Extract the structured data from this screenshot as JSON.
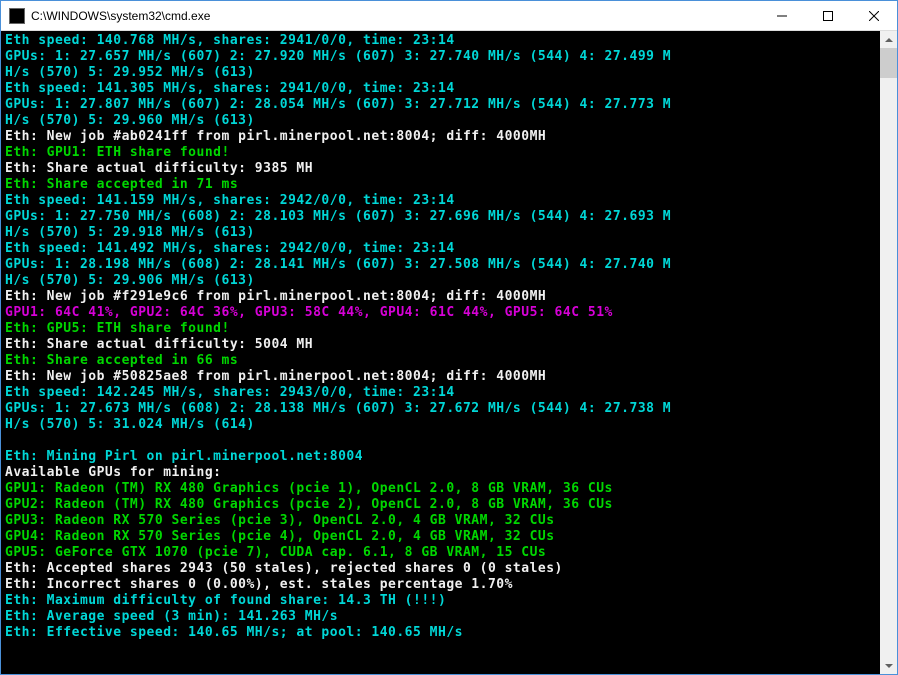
{
  "window": {
    "title": "C:\\WINDOWS\\system32\\cmd.exe"
  },
  "lines": [
    {
      "cls": "cyan",
      "key": "l00",
      "text": "Eth speed: 140.768 MH/s, shares: 2941/0/0, time: 23:14"
    },
    {
      "cls": "cyan",
      "key": "l01",
      "text": "GPUs: 1: 27.657 MH/s (607) 2: 27.920 MH/s (607) 3: 27.740 MH/s (544) 4: 27.499 M"
    },
    {
      "cls": "cyan",
      "key": "l02",
      "text": "H/s (570) 5: 29.952 MH/s (613)"
    },
    {
      "cls": "cyan",
      "key": "l03",
      "text": "Eth speed: 141.305 MH/s, shares: 2941/0/0, time: 23:14"
    },
    {
      "cls": "cyan",
      "key": "l04",
      "text": "GPUs: 1: 27.807 MH/s (607) 2: 28.054 MH/s (607) 3: 27.712 MH/s (544) 4: 27.773 M"
    },
    {
      "cls": "cyan",
      "key": "l05",
      "text": "H/s (570) 5: 29.960 MH/s (613)"
    },
    {
      "cls": "white",
      "key": "l06",
      "text": "Eth: New job #ab0241ff from pirl.minerpool.net:8004; diff: 4000MH"
    },
    {
      "cls": "green",
      "key": "l07",
      "text": "Eth: GPU1: ETH share found!"
    },
    {
      "cls": "white",
      "key": "l08",
      "text": "Eth: Share actual difficulty: 9385 MH"
    },
    {
      "cls": "green",
      "key": "l09",
      "text": "Eth: Share accepted in 71 ms"
    },
    {
      "cls": "cyan",
      "key": "l10",
      "text": "Eth speed: 141.159 MH/s, shares: 2942/0/0, time: 23:14"
    },
    {
      "cls": "cyan",
      "key": "l11",
      "text": "GPUs: 1: 27.750 MH/s (608) 2: 28.103 MH/s (607) 3: 27.696 MH/s (544) 4: 27.693 M"
    },
    {
      "cls": "cyan",
      "key": "l12",
      "text": "H/s (570) 5: 29.918 MH/s (613)"
    },
    {
      "cls": "cyan",
      "key": "l13",
      "text": "Eth speed: 141.492 MH/s, shares: 2942/0/0, time: 23:14"
    },
    {
      "cls": "cyan",
      "key": "l14",
      "text": "GPUs: 1: 28.198 MH/s (608) 2: 28.141 MH/s (607) 3: 27.508 MH/s (544) 4: 27.740 M"
    },
    {
      "cls": "cyan",
      "key": "l15",
      "text": "H/s (570) 5: 29.906 MH/s (613)"
    },
    {
      "cls": "white",
      "key": "l16",
      "text": "Eth: New job #f291e9c6 from pirl.minerpool.net:8004; diff: 4000MH"
    },
    {
      "cls": "magenta",
      "key": "l17",
      "text": "GPU1: 64C 41%, GPU2: 64C 36%, GPU3: 58C 44%, GPU4: 61C 44%, GPU5: 64C 51%"
    },
    {
      "cls": "green",
      "key": "l18",
      "text": "Eth: GPU5: ETH share found!"
    },
    {
      "cls": "white",
      "key": "l19",
      "text": "Eth: Share actual difficulty: 5004 MH"
    },
    {
      "cls": "green",
      "key": "l20",
      "text": "Eth: Share accepted in 66 ms"
    },
    {
      "cls": "white",
      "key": "l21",
      "text": "Eth: New job #50825ae8 from pirl.minerpool.net:8004; diff: 4000MH"
    },
    {
      "cls": "cyan",
      "key": "l22",
      "text": "Eth speed: 142.245 MH/s, shares: 2943/0/0, time: 23:14"
    },
    {
      "cls": "cyan",
      "key": "l23",
      "text": "GPUs: 1: 27.673 MH/s (608) 2: 28.138 MH/s (607) 3: 27.672 MH/s (544) 4: 27.738 M"
    },
    {
      "cls": "cyan",
      "key": "l24",
      "text": "H/s (570) 5: 31.024 MH/s (614)"
    },
    {
      "cls": "",
      "key": "l25",
      "text": " "
    },
    {
      "cls": "cyan",
      "key": "l26",
      "text": "Eth: Mining Pirl on pirl.minerpool.net:8004"
    },
    {
      "cls": "white",
      "key": "l27",
      "text": "Available GPUs for mining:"
    },
    {
      "cls": "green",
      "key": "l28",
      "text": "GPU1: Radeon (TM) RX 480 Graphics (pcie 1), OpenCL 2.0, 8 GB VRAM, 36 CUs"
    },
    {
      "cls": "green",
      "key": "l29",
      "text": "GPU2: Radeon (TM) RX 480 Graphics (pcie 2), OpenCL 2.0, 8 GB VRAM, 36 CUs"
    },
    {
      "cls": "green",
      "key": "l30",
      "text": "GPU3: Radeon RX 570 Series (pcie 3), OpenCL 2.0, 4 GB VRAM, 32 CUs"
    },
    {
      "cls": "green",
      "key": "l31",
      "text": "GPU4: Radeon RX 570 Series (pcie 4), OpenCL 2.0, 4 GB VRAM, 32 CUs"
    },
    {
      "cls": "green",
      "key": "l32",
      "text": "GPU5: GeForce GTX 1070 (pcie 7), CUDA cap. 6.1, 8 GB VRAM, 15 CUs"
    },
    {
      "cls": "white",
      "key": "l33",
      "text": "Eth: Accepted shares 2943 (50 stales), rejected shares 0 (0 stales)"
    },
    {
      "cls": "white",
      "key": "l34",
      "text": "Eth: Incorrect shares 0 (0.00%), est. stales percentage 1.70%"
    },
    {
      "cls": "cyan",
      "key": "l35",
      "text": "Eth: Maximum difficulty of found share: 14.3 TH (!!!)"
    },
    {
      "cls": "cyan",
      "key": "l36",
      "text": "Eth: Average speed (3 min): 141.263 MH/s"
    },
    {
      "cls": "cyan",
      "key": "l37",
      "text": "Eth: Effective speed: 140.65 MH/s; at pool: 140.65 MH/s"
    }
  ]
}
